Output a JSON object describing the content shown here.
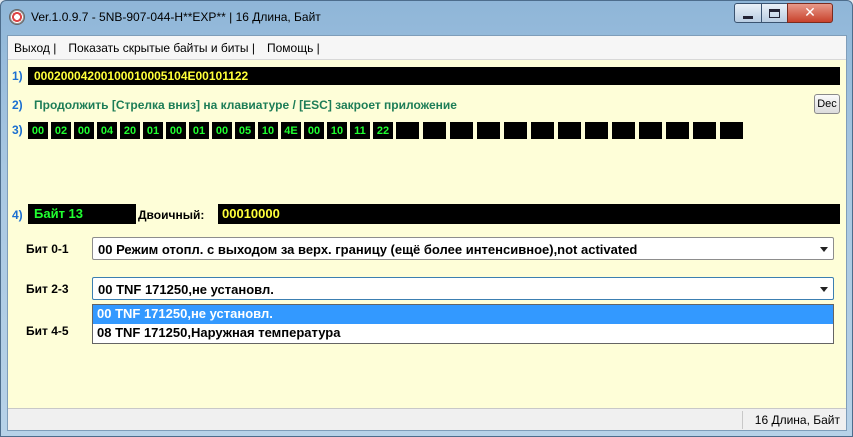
{
  "window": {
    "title": "Ver.1.0.9.7 -    5NB-907-044-H**EXP** | 16 Длина, Байт",
    "app_icon": "app-icon",
    "controls": [
      "minimize-icon",
      "maximize-icon",
      "close-icon"
    ]
  },
  "menu": [
    "Выход |",
    "Показать скрытые байты и биты |",
    "Помощь |"
  ],
  "row1": {
    "num": "1)",
    "ident": "00020004200100010005104E00101122"
  },
  "row2": {
    "num": "2)",
    "hint": "Продолжить [Стрелка вниз] на клавиатуре / [ESC] закроет приложение",
    "dec_button": "Dec"
  },
  "row3": {
    "num": "3)",
    "bytes": [
      "00",
      "02",
      "00",
      "04",
      "20",
      "01",
      "00",
      "01",
      "00",
      "05",
      "10",
      "4E",
      "00",
      "10",
      "11",
      "22"
    ],
    "empty_cells": 13
  },
  "row4": {
    "num": "4)",
    "byte_label": "Байт 13",
    "binary_label": "Двоичный:",
    "binary_value": "00010000"
  },
  "bits": [
    {
      "label": "Бит 0-1",
      "value": "00 Режим отопл. с выходом за верх. границу (ещё более интенсивное),not activated"
    },
    {
      "label": "Бит 2-3",
      "value": "00 TNF 171250,не установл."
    },
    {
      "label": "Бит 4-5",
      "value": ""
    }
  ],
  "dropdown_options": [
    {
      "text": "00 TNF 171250,не установл.",
      "selected": true
    },
    {
      "text": "08 TNF 171250,Наружная температура",
      "selected": false
    }
  ],
  "status": {
    "text": "16 Длина, Байт"
  },
  "colors": {
    "accent_yellow": "#ffff3a",
    "accent_green": "#20ff30",
    "hint_green": "#1d7d57",
    "row_num_blue": "#1b6fd1",
    "client_bg": "#fefed8",
    "selection": "#3399ff"
  }
}
